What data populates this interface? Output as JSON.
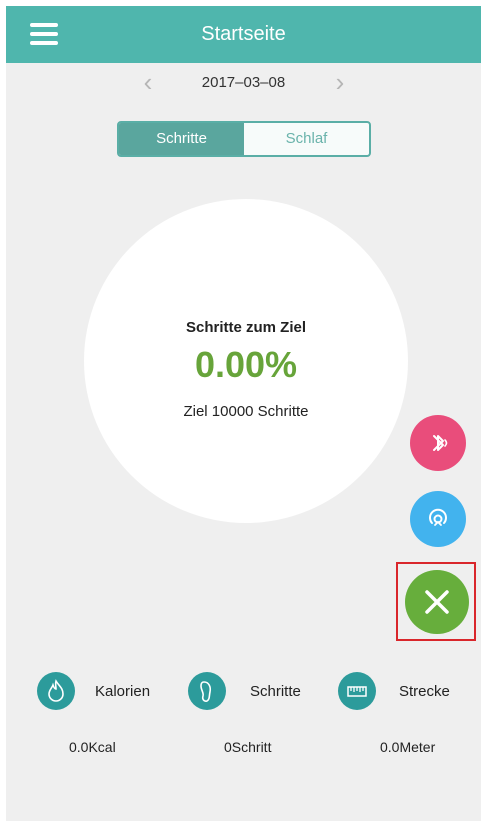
{
  "header": {
    "title": "Startseite",
    "menu_icon": "hamburger-menu-icon",
    "bar_color": "#4fb6ad"
  },
  "date_nav": {
    "date": "2017–03–08",
    "prev_glyph": "‹",
    "next_glyph": "›"
  },
  "segment": {
    "options": [
      "Schritte",
      "Schlaf"
    ],
    "selected": "Schritte"
  },
  "progress": {
    "label": "Schritte zum Ziel",
    "percent_text": "0.00%",
    "percent": 0,
    "goal_text": "Ziel 10000 Schritte",
    "percent_color": "#67a43a"
  },
  "fab": {
    "bluetooth_color": "#e94d7b",
    "sync_color": "#42b3ee",
    "close_color": "#67ae3c",
    "icons": [
      "bluetooth-icon",
      "sync-icon",
      "close-icon"
    ]
  },
  "stats": [
    {
      "icon": "flame-icon",
      "label": "Kalorien",
      "value": "0.0Kcal"
    },
    {
      "icon": "footprint-icon",
      "label": "Schritte",
      "value": "0Schritt"
    },
    {
      "icon": "ruler-icon",
      "label": "Strecke",
      "value": "0.0Meter"
    }
  ]
}
